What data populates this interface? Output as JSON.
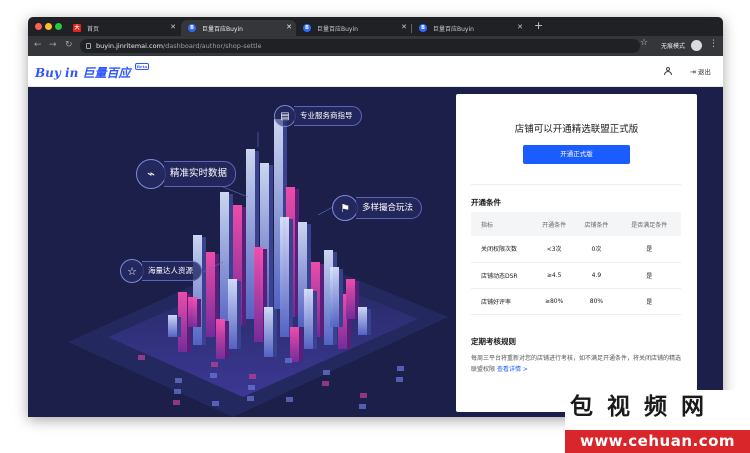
{
  "browser": {
    "tabs": [
      {
        "title": "首页",
        "favicon": "jd-icon",
        "active": false
      },
      {
        "title": "巨量百应Buyin",
        "favicon": "buyin-icon",
        "active": true
      },
      {
        "title": "巨量百应Buyin",
        "favicon": "buyin-icon",
        "active": false
      },
      {
        "title": "巨量百应Buyin",
        "favicon": "buyin-icon",
        "active": false
      }
    ],
    "new_tab_label": "+",
    "url_host": "buyin.jinritemai.com",
    "url_path": "/dashboard/author/shop-settle",
    "incognito_label": "无痕模式"
  },
  "header": {
    "logo_text": "Buy in 巨量百应",
    "logo_badge": "Beta",
    "logout_label": "退出"
  },
  "hero": {
    "features": [
      {
        "label": "专业服务商指导",
        "icon": "document-icon"
      },
      {
        "label": "精准实时数据",
        "icon": "chart-icon"
      },
      {
        "label": "多样撮合玩法",
        "icon": "flag-icon"
      },
      {
        "label": "海量达人资源",
        "icon": "star-icon"
      }
    ]
  },
  "card": {
    "title": "店铺可以开通精选联盟正式版",
    "button_label": "开通正式版",
    "conditions_title": "开通条件",
    "table_headers": [
      "指标",
      "开通条件",
      "店铺条件",
      "是否满足条件"
    ],
    "table_rows": [
      [
        "关闭权限次数",
        "<3次",
        "0次",
        "是"
      ],
      [
        "店铺动态DSR",
        "≥4.5",
        "4.9",
        "是"
      ],
      [
        "店铺好评率",
        "≥80%",
        "80%",
        "是"
      ]
    ],
    "rules_title": "定期考核规则",
    "rules_text": "每周三平台将重新对您的店铺进行考核，如不满足开通条件，将关闭店铺的精选联盟权限",
    "rules_link": "查看详情 >"
  },
  "watermark": {
    "top_text": "包 视 频 网",
    "bottom_text": "www.cehuan.com"
  },
  "colors": {
    "brand_blue": "#1b5cff",
    "hero_bg": "#1c1f4a",
    "chrome_dark": "#202124",
    "watermark_red": "#d8262b"
  }
}
